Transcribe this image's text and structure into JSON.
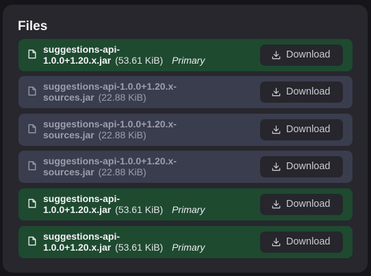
{
  "section": {
    "title": "Files"
  },
  "files": [
    {
      "name_line1": "suggestions-api-",
      "name_line2": "1.0.0+1.20.x.jar",
      "size": "(53.61 KiB)",
      "tag": "Primary",
      "variant": "primary",
      "button_label": "Download"
    },
    {
      "name_line1": "suggestions-api-1.0.0+1.20.x-",
      "name_line2": "sources.jar",
      "size": "(22.88 KiB)",
      "tag": "",
      "variant": "secondary",
      "button_label": "Download"
    },
    {
      "name_line1": "suggestions-api-1.0.0+1.20.x-",
      "name_line2": "sources.jar",
      "size": "(22.88 KiB)",
      "tag": "",
      "variant": "secondary",
      "button_label": "Download"
    },
    {
      "name_line1": "suggestions-api-1.0.0+1.20.x-",
      "name_line2": "sources.jar",
      "size": "(22.88 KiB)",
      "tag": "",
      "variant": "secondary",
      "button_label": "Download"
    },
    {
      "name_line1": "suggestions-api-",
      "name_line2": "1.0.0+1.20.x.jar",
      "size": "(53.61 KiB)",
      "tag": "Primary",
      "variant": "primary",
      "button_label": "Download"
    },
    {
      "name_line1": "suggestions-api-",
      "name_line2": "1.0.0+1.20.x.jar",
      "size": "(53.61 KiB)",
      "tag": "Primary",
      "variant": "primary",
      "button_label": "Download"
    }
  ],
  "icons": {
    "file": "file-icon",
    "download": "download-icon"
  },
  "colors": {
    "panel_background": "#27272d",
    "primary_row": "#1e4a30",
    "secondary_row": "#3a3d4e",
    "button_background": "#26262c"
  }
}
